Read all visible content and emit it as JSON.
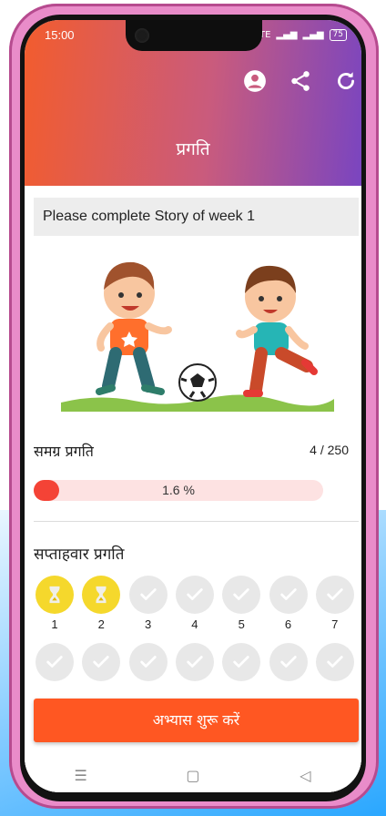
{
  "status_bar": {
    "time": "15:00",
    "network": "Vo LTE",
    "battery": "75"
  },
  "header": {
    "title": "प्रगति"
  },
  "banner": {
    "text": "Please complete Story of week 1"
  },
  "overall": {
    "label": "समग्र प्रगति",
    "count": "4 / 250",
    "percent_text": "1.6 %",
    "progress": 0.016
  },
  "weekly": {
    "label": "सप्ताहवार प्रगति",
    "row1": [
      {
        "num": "1",
        "state": "in-progress",
        "icon": "hourglass-icon"
      },
      {
        "num": "2",
        "state": "in-progress",
        "icon": "hourglass-icon"
      },
      {
        "num": "3",
        "state": "locked",
        "icon": "check-icon"
      },
      {
        "num": "4",
        "state": "locked",
        "icon": "check-icon"
      },
      {
        "num": "5",
        "state": "locked",
        "icon": "check-icon"
      },
      {
        "num": "6",
        "state": "locked",
        "icon": "check-icon"
      },
      {
        "num": "7",
        "state": "locked",
        "icon": "check-icon"
      }
    ],
    "row2_count_visible": 7
  },
  "action": {
    "start_label": "अभ्यास शुरू करें"
  },
  "colors": {
    "accent": "#ff5722",
    "active_week": "#f5d82c",
    "progress_fill": "#f44336",
    "progress_track": "#fde2e2"
  }
}
